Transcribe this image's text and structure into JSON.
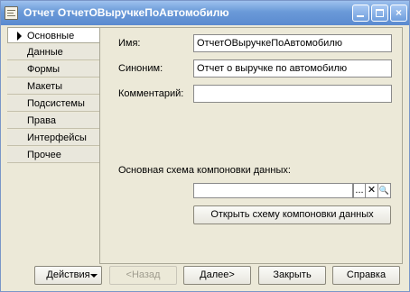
{
  "window": {
    "title": "Отчет ОтчетОВыручкеПоАвтомобилю"
  },
  "tabs": [
    {
      "label": "Основные",
      "active": true
    },
    {
      "label": "Данные"
    },
    {
      "label": "Формы"
    },
    {
      "label": "Макеты"
    },
    {
      "label": "Подсистемы"
    },
    {
      "label": "Права"
    },
    {
      "label": "Интерфейсы"
    },
    {
      "label": "Прочее"
    }
  ],
  "form": {
    "name_label": "Имя:",
    "name_value": "ОтчетОВыручкеПоАвтомобилю",
    "synonym_label": "Синоним:",
    "synonym_value": "Отчет о выручке по автомобилю",
    "comment_label": "Комментарий:",
    "comment_value": "",
    "schema_label": "Основная схема компоновки данных:",
    "schema_value": "",
    "ellipsis": "...",
    "clear": "✕",
    "search": "🔍",
    "open_schema_button": "Открыть схему компоновки данных"
  },
  "footer": {
    "actions": "Действия",
    "back": "<Назад",
    "next": "Далее>",
    "close": "Закрыть",
    "help": "Справка"
  }
}
